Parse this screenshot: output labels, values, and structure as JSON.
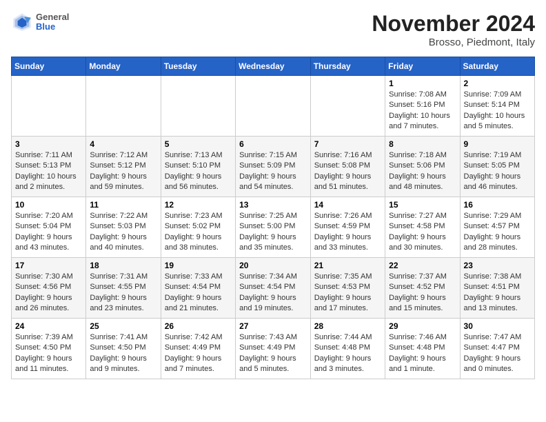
{
  "header": {
    "logo": {
      "general": "General",
      "blue": "Blue"
    },
    "month": "November 2024",
    "location": "Brosso, Piedmont, Italy"
  },
  "weekdays": [
    "Sunday",
    "Monday",
    "Tuesday",
    "Wednesday",
    "Thursday",
    "Friday",
    "Saturday"
  ],
  "weeks": [
    [
      {
        "day": "",
        "info": ""
      },
      {
        "day": "",
        "info": ""
      },
      {
        "day": "",
        "info": ""
      },
      {
        "day": "",
        "info": ""
      },
      {
        "day": "",
        "info": ""
      },
      {
        "day": "1",
        "info": "Sunrise: 7:08 AM\nSunset: 5:16 PM\nDaylight: 10 hours and 7 minutes."
      },
      {
        "day": "2",
        "info": "Sunrise: 7:09 AM\nSunset: 5:14 PM\nDaylight: 10 hours and 5 minutes."
      }
    ],
    [
      {
        "day": "3",
        "info": "Sunrise: 7:11 AM\nSunset: 5:13 PM\nDaylight: 10 hours and 2 minutes."
      },
      {
        "day": "4",
        "info": "Sunrise: 7:12 AM\nSunset: 5:12 PM\nDaylight: 9 hours and 59 minutes."
      },
      {
        "day": "5",
        "info": "Sunrise: 7:13 AM\nSunset: 5:10 PM\nDaylight: 9 hours and 56 minutes."
      },
      {
        "day": "6",
        "info": "Sunrise: 7:15 AM\nSunset: 5:09 PM\nDaylight: 9 hours and 54 minutes."
      },
      {
        "day": "7",
        "info": "Sunrise: 7:16 AM\nSunset: 5:08 PM\nDaylight: 9 hours and 51 minutes."
      },
      {
        "day": "8",
        "info": "Sunrise: 7:18 AM\nSunset: 5:06 PM\nDaylight: 9 hours and 48 minutes."
      },
      {
        "day": "9",
        "info": "Sunrise: 7:19 AM\nSunset: 5:05 PM\nDaylight: 9 hours and 46 minutes."
      }
    ],
    [
      {
        "day": "10",
        "info": "Sunrise: 7:20 AM\nSunset: 5:04 PM\nDaylight: 9 hours and 43 minutes."
      },
      {
        "day": "11",
        "info": "Sunrise: 7:22 AM\nSunset: 5:03 PM\nDaylight: 9 hours and 40 minutes."
      },
      {
        "day": "12",
        "info": "Sunrise: 7:23 AM\nSunset: 5:02 PM\nDaylight: 9 hours and 38 minutes."
      },
      {
        "day": "13",
        "info": "Sunrise: 7:25 AM\nSunset: 5:00 PM\nDaylight: 9 hours and 35 minutes."
      },
      {
        "day": "14",
        "info": "Sunrise: 7:26 AM\nSunset: 4:59 PM\nDaylight: 9 hours and 33 minutes."
      },
      {
        "day": "15",
        "info": "Sunrise: 7:27 AM\nSunset: 4:58 PM\nDaylight: 9 hours and 30 minutes."
      },
      {
        "day": "16",
        "info": "Sunrise: 7:29 AM\nSunset: 4:57 PM\nDaylight: 9 hours and 28 minutes."
      }
    ],
    [
      {
        "day": "17",
        "info": "Sunrise: 7:30 AM\nSunset: 4:56 PM\nDaylight: 9 hours and 26 minutes."
      },
      {
        "day": "18",
        "info": "Sunrise: 7:31 AM\nSunset: 4:55 PM\nDaylight: 9 hours and 23 minutes."
      },
      {
        "day": "19",
        "info": "Sunrise: 7:33 AM\nSunset: 4:54 PM\nDaylight: 9 hours and 21 minutes."
      },
      {
        "day": "20",
        "info": "Sunrise: 7:34 AM\nSunset: 4:54 PM\nDaylight: 9 hours and 19 minutes."
      },
      {
        "day": "21",
        "info": "Sunrise: 7:35 AM\nSunset: 4:53 PM\nDaylight: 9 hours and 17 minutes."
      },
      {
        "day": "22",
        "info": "Sunrise: 7:37 AM\nSunset: 4:52 PM\nDaylight: 9 hours and 15 minutes."
      },
      {
        "day": "23",
        "info": "Sunrise: 7:38 AM\nSunset: 4:51 PM\nDaylight: 9 hours and 13 minutes."
      }
    ],
    [
      {
        "day": "24",
        "info": "Sunrise: 7:39 AM\nSunset: 4:50 PM\nDaylight: 9 hours and 11 minutes."
      },
      {
        "day": "25",
        "info": "Sunrise: 7:41 AM\nSunset: 4:50 PM\nDaylight: 9 hours and 9 minutes."
      },
      {
        "day": "26",
        "info": "Sunrise: 7:42 AM\nSunset: 4:49 PM\nDaylight: 9 hours and 7 minutes."
      },
      {
        "day": "27",
        "info": "Sunrise: 7:43 AM\nSunset: 4:49 PM\nDaylight: 9 hours and 5 minutes."
      },
      {
        "day": "28",
        "info": "Sunrise: 7:44 AM\nSunset: 4:48 PM\nDaylight: 9 hours and 3 minutes."
      },
      {
        "day": "29",
        "info": "Sunrise: 7:46 AM\nSunset: 4:48 PM\nDaylight: 9 hours and 1 minute."
      },
      {
        "day": "30",
        "info": "Sunrise: 7:47 AM\nSunset: 4:47 PM\nDaylight: 9 hours and 0 minutes."
      }
    ]
  ]
}
